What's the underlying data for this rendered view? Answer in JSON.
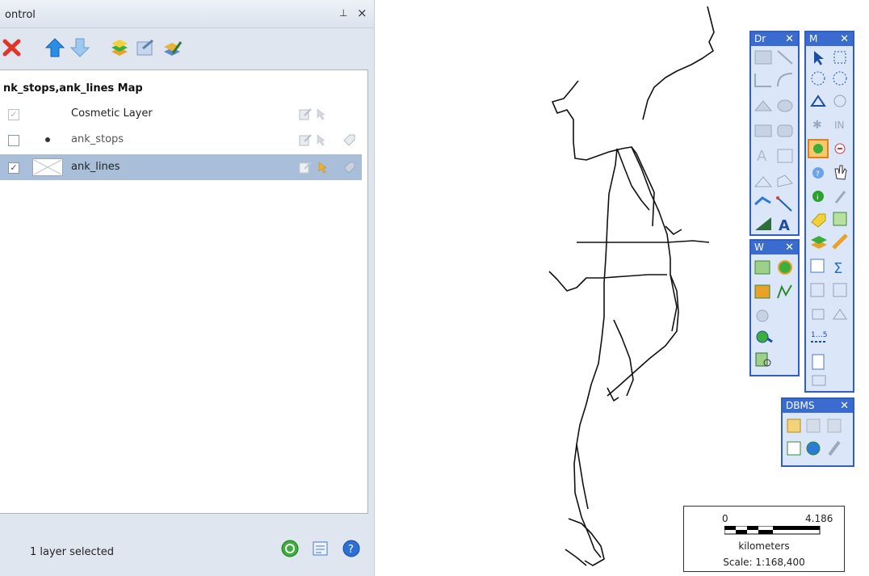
{
  "panel": {
    "title": "ontrol",
    "pin_icon": "pin-icon",
    "close_glyph": "×"
  },
  "toolbar": {
    "buttons": [
      "remove-layer-icon",
      "move-up-icon",
      "move-down-icon",
      "add-layers-icon",
      "layer-properties-icon",
      "edit-layer-icon"
    ]
  },
  "map": {
    "title": "nk_stops,ank_lines Map",
    "layers": [
      {
        "name": "Cosmetic Layer",
        "checked": true,
        "disabled": true
      },
      {
        "name": "ank_stops",
        "checked": false,
        "disabled": false
      },
      {
        "name": "ank_lines",
        "checked": true,
        "disabled": false,
        "selected": true
      }
    ]
  },
  "status": {
    "text": "1 layer selected"
  },
  "windows": {
    "draw": {
      "title": "Dr",
      "close": "✕"
    },
    "main": {
      "title": "M",
      "close": "✕"
    },
    "web": {
      "title": "W",
      "close": "✕"
    },
    "dbms": {
      "title": "DBMS",
      "close": "✕"
    }
  },
  "scalebar": {
    "start": "0",
    "end": "4.186",
    "unit": "kilometers",
    "scale": "Scale: 1:168,400"
  },
  "colors": {
    "accent": "#2f5fbf",
    "selected_row": "#a9bfd9",
    "panel_bg": "#dfe6ef"
  }
}
